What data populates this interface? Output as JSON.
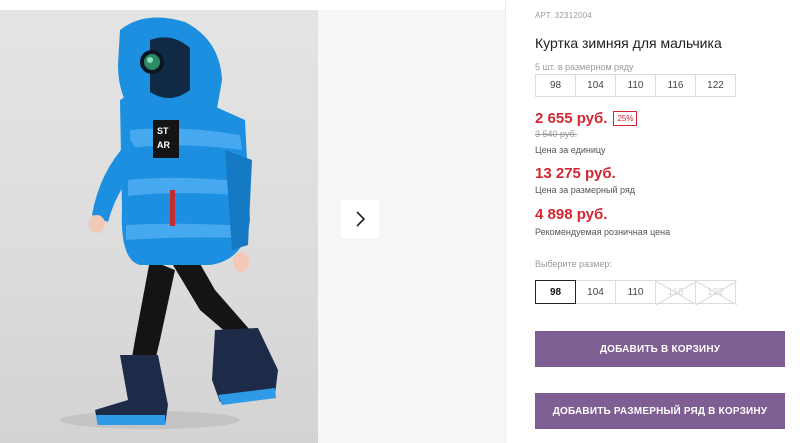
{
  "gallery": {
    "next_icon": "chevron-right-icon",
    "jacket_print": [
      "ST",
      "AR"
    ]
  },
  "product": {
    "sku": "АРТ. 32312004",
    "title": "Куртка зимняя для мальчика",
    "pack_label": "5 шт. в размерном ряду",
    "pack_sizes": [
      "98",
      "104",
      "110",
      "116",
      "122"
    ],
    "price": "2 655 руб.",
    "discount": "25%",
    "old_price": "3 540 руб.",
    "per_unit": "Цена за единицу",
    "pack_price": "13 275 руб.",
    "pack_caption": "Цена за размерный ряд",
    "rrp_price": "4 898 руб.",
    "rrp_caption": "Рекомендуемая розничная цена"
  },
  "size_picker": {
    "label": "Выберите размер:",
    "sizes": [
      {
        "label": "98",
        "state": "selected"
      },
      {
        "label": "104",
        "state": "available"
      },
      {
        "label": "110",
        "state": "available"
      },
      {
        "label": "116",
        "state": "unavailable"
      },
      {
        "label": "122",
        "state": "unavailable"
      }
    ]
  },
  "actions": {
    "add_to_cart": "ДОБАВИТЬ В КОРЗИНУ",
    "add_pack_to_cart": "ДОБАВИТЬ РАЗМЕРНЫЙ РЯД В КОРЗИНУ"
  },
  "colors": {
    "price_red": "#d22732",
    "button_purple": "#7e5e93",
    "jacket_blue": "#1c8fe0"
  }
}
